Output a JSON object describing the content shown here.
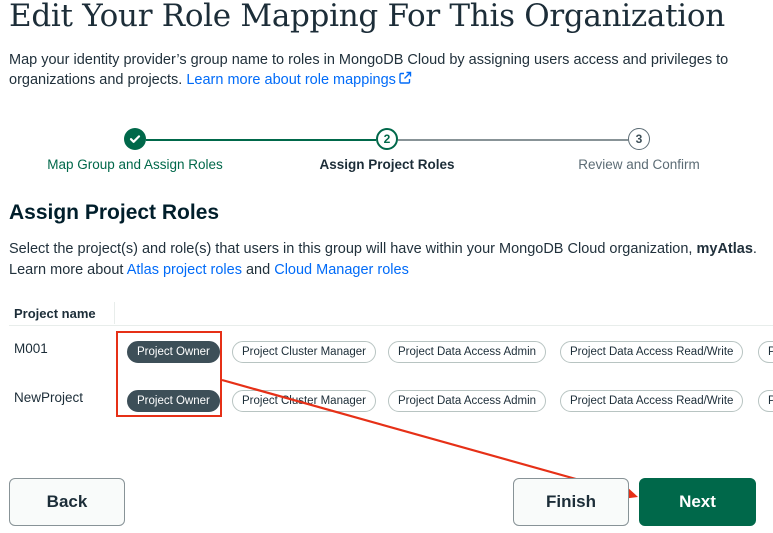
{
  "header": {
    "title": "Edit Your Role Mapping For This Organization",
    "intro": "Map your identity provider’s group name to roles in MongoDB Cloud by assigning users access and privileges to organizations and projects.",
    "learn_more_link": "Learn more about role mappings"
  },
  "stepper": {
    "steps": [
      {
        "number": "1",
        "label": "Map Group and Assign Roles",
        "state": "complete"
      },
      {
        "number": "2",
        "label": "Assign Project Roles",
        "state": "current"
      },
      {
        "number": "3",
        "label": "Review and Confirm",
        "state": "upcoming"
      }
    ]
  },
  "section": {
    "title": "Assign Project Roles",
    "desc_prefix": "Select the project(s) and role(s) that users in this group will have within your MongoDB Cloud organization,",
    "org_name": "myAtlas",
    "desc_learn": "Learn more about",
    "atlas_link": "Atlas project roles",
    "and": "and",
    "cloud_link": "Cloud Manager roles"
  },
  "table": {
    "header": "Project name",
    "rows": [
      {
        "name": "M001",
        "roles": [
          {
            "label": "Project Owner",
            "selected": true
          },
          {
            "label": "Project Cluster Manager",
            "selected": false
          },
          {
            "label": "Project Data Access Admin",
            "selected": false
          },
          {
            "label": "Project Data Access Read/Write",
            "selected": false
          },
          {
            "label": "P",
            "selected": false
          }
        ]
      },
      {
        "name": "NewProject",
        "roles": [
          {
            "label": "Project Owner",
            "selected": true
          },
          {
            "label": "Project Cluster Manager",
            "selected": false
          },
          {
            "label": "Project Data Access Admin",
            "selected": false
          },
          {
            "label": "Project Data Access Read/Write",
            "selected": false
          },
          {
            "label": "P",
            "selected": false
          }
        ]
      }
    ]
  },
  "footer": {
    "back_label": "Back",
    "finish_label": "Finish",
    "next_label": "Next"
  },
  "colors": {
    "brand_green": "#00684a",
    "link_blue": "#016bf8",
    "chip_selected": "#3d4f58",
    "annotation_red": "#e63017"
  }
}
